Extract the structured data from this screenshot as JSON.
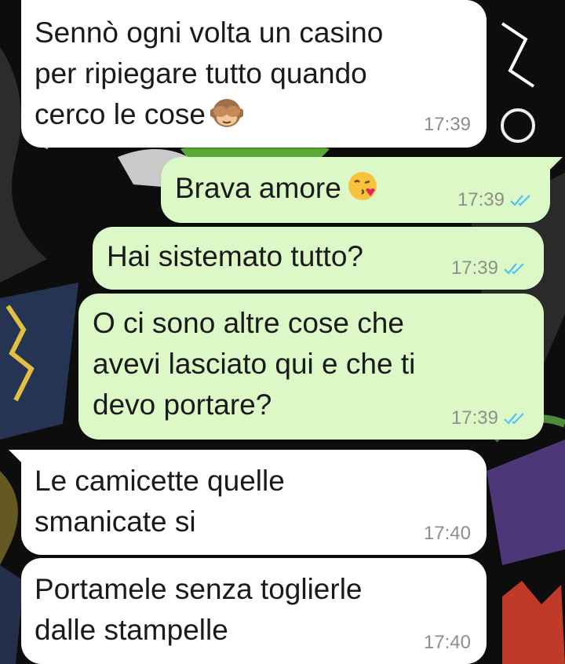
{
  "messages": [
    {
      "direction": "incoming",
      "lines": [
        "Sennò ogni volta un casino",
        "per ripiegare tutto quando",
        "cerco le cose"
      ],
      "emoji": "see-no-evil-monkey-icon",
      "time": "17:39"
    },
    {
      "direction": "outgoing",
      "lines": [
        "Brava amore"
      ],
      "emoji": "face-blowing-kiss-icon",
      "time": "17:39",
      "status": "read"
    },
    {
      "direction": "outgoing",
      "lines": [
        "Hai sistemato tutto?"
      ],
      "time": "17:39",
      "status": "read"
    },
    {
      "direction": "outgoing",
      "lines": [
        "O ci sono altre cose che",
        "avevi lasciato qui e che ti",
        "devo portare?"
      ],
      "time": "17:39",
      "status": "read"
    },
    {
      "direction": "incoming",
      "lines": [
        "Le camicette quelle",
        "smanicate si"
      ],
      "time": "17:40"
    },
    {
      "direction": "incoming",
      "lines": [
        "Portamele senza toglierle",
        "dalle stampelle"
      ],
      "time": "17:40"
    }
  ],
  "colors": {
    "incoming_bubble": "#ffffff",
    "outgoing_bubble": "#dcf8c6",
    "read_ticks": "#4fc3f7",
    "timestamp": "#8e8e8e"
  }
}
